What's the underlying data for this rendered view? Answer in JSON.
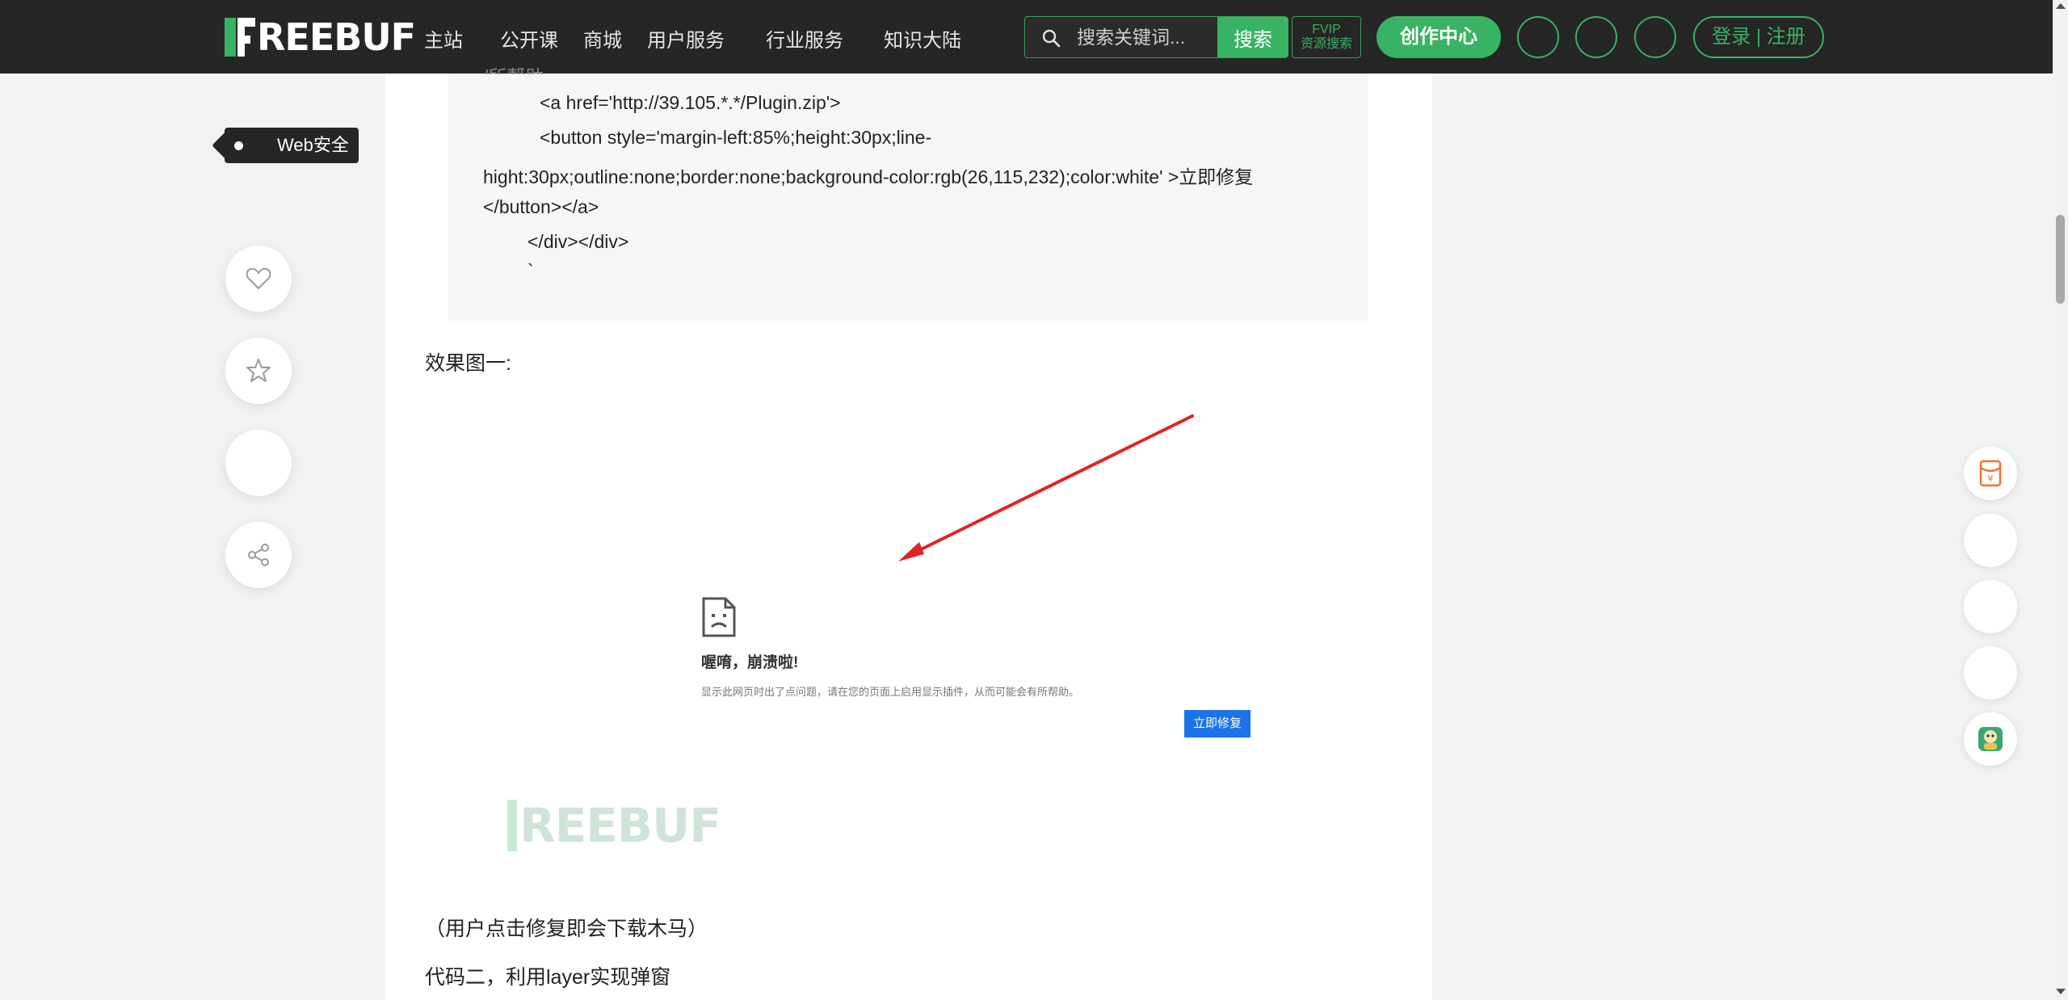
{
  "header": {
    "logo_text": "REEBUF",
    "nav": [
      "主站",
      "公开课",
      "商城",
      "用户服务",
      "行业服务",
      "知识大陆"
    ],
    "search_placeholder": "搜索关键词...",
    "search_button": "搜索",
    "fvip_line1": "FVIP",
    "fvip_line2": "资源搜索",
    "create_center": "创作中心",
    "login": "登录 | 注册"
  },
  "sidebar": {
    "tag": "Web安全"
  },
  "article": {
    "code_lines": [
      "<a href='http://39.105.*.*/Plugin.zip'>",
      "<button style='margin-left:85%;height:30px;line-",
      "hight:30px;outline:none;border:none;background-color:rgb(26,115,232);color:white'  >立即修复",
      "</button></a>",
      "</div></div>",
      "`"
    ],
    "effect_heading": "效果图一:",
    "figure": {
      "crash_title": "喔唷，崩溃啦!",
      "crash_desc": "显示此网页时出了点问题，请在您的页面上启用显示插件，从而可能会有所帮助。",
      "fix_button": "立即修复",
      "watermark": "REEBUF"
    },
    "caption": "（用户点击修复即会下载木马）",
    "next_heading": "代码二，利用layer实现弹窗"
  },
  "colors": {
    "brand_green": "#38b363",
    "header_bg": "#262626",
    "fix_blue": "#1a73e8",
    "arrow_red": "#e02424"
  }
}
